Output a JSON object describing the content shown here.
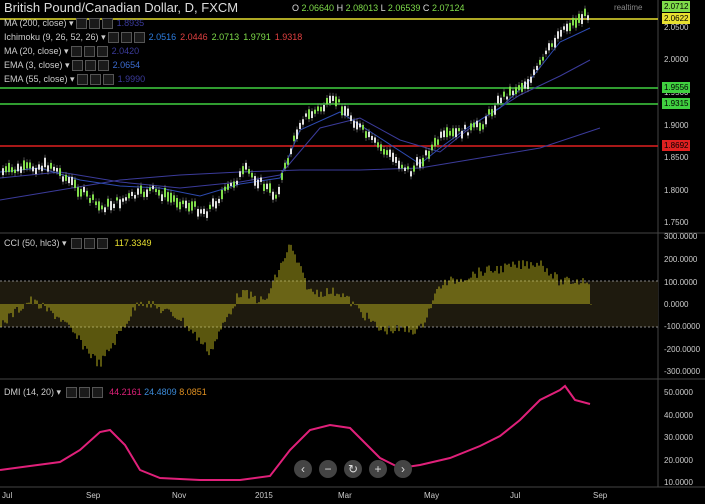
{
  "header": {
    "title": "British Pound/Canadian Dollar, D, FXCM",
    "realtime": "realtime",
    "ohlc": {
      "o_label": "O",
      "o": "2.06640",
      "h_label": "H",
      "h": "2.08013",
      "l_label": "L",
      "l": "2.06539",
      "c_label": "C",
      "c": "2.07124"
    }
  },
  "indicators": [
    {
      "label": "MA (200, close)",
      "values": [
        "1.8935"
      ],
      "colors": [
        "#3b3b9a"
      ]
    },
    {
      "label": "Ichimoku (9, 26, 52, 26)",
      "values": [
        "2.0516",
        "2.0446",
        "2.0713",
        "1.9791",
        "1.9318"
      ],
      "colors": [
        "#2d7de0",
        "#e04040",
        "#7fdc4a",
        "#7fdc4a",
        "#e04040"
      ]
    },
    {
      "label": "MA (20, close)",
      "values": [
        "2.0420"
      ],
      "colors": [
        "#3b3b9a"
      ]
    },
    {
      "label": "EMA (3, close)",
      "values": [
        "2.0654"
      ],
      "colors": [
        "#3b6bd0"
      ]
    },
    {
      "label": "EMA (55, close)",
      "values": [
        "1.9990"
      ],
      "colors": [
        "#3b3b9a"
      ]
    }
  ],
  "cci_panel": {
    "label": "CCI (50, hlc3)",
    "value": "117.3349",
    "color": "#e8e030"
  },
  "dmi_panel": {
    "label": "DMI (14, 20)",
    "values": [
      "44.2161",
      "24.4809",
      "8.0851"
    ],
    "colors": [
      "#e0207a",
      "#3b8ad8",
      "#e09020"
    ]
  },
  "price_axis": {
    "ticks": [
      "2.0500",
      "2.0000",
      "1.9500",
      "1.9000",
      "1.8500",
      "1.8000",
      "1.7500"
    ],
    "tags": [
      {
        "text": "2.0712",
        "color": "#7fdc4a"
      },
      {
        "text": "2.0622",
        "color": "#e8e030"
      },
      {
        "text": "1.9556",
        "color": "#40d040"
      },
      {
        "text": "1.9315",
        "color": "#40d040"
      },
      {
        "text": "1.8692",
        "color": "#e02020"
      }
    ]
  },
  "cci_axis": {
    "ticks": [
      "300.0000",
      "200.0000",
      "100.0000",
      "0.0000",
      "-100.0000",
      "-200.0000",
      "-300.0000"
    ]
  },
  "dmi_axis": {
    "ticks": [
      "50.0000",
      "40.0000",
      "30.0000",
      "20.0000",
      "10.0000"
    ]
  },
  "time_axis": [
    "Jul",
    "Sep",
    "Nov",
    "2015",
    "Mar",
    "May",
    "Jul",
    "Sep"
  ],
  "zoom_controls": [
    {
      "name": "scroll-left",
      "glyph": "‹"
    },
    {
      "name": "zoom-out",
      "glyph": "−"
    },
    {
      "name": "reset",
      "glyph": "↻"
    },
    {
      "name": "zoom-in",
      "glyph": "+"
    },
    {
      "name": "scroll-right",
      "glyph": "›"
    }
  ]
}
